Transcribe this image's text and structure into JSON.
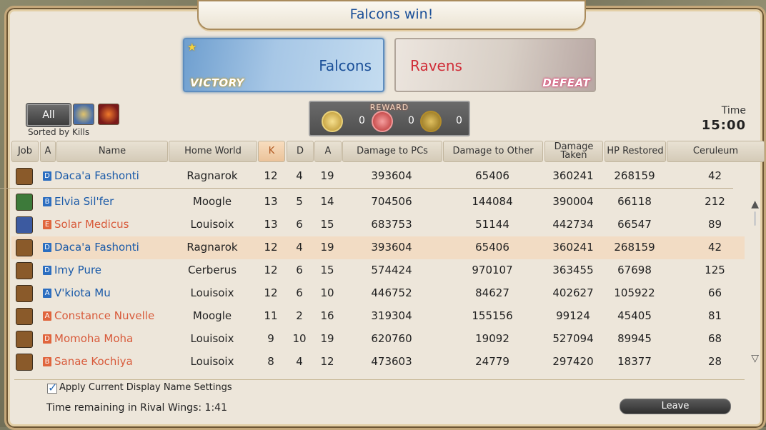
{
  "title": "Falcons win!",
  "teams": {
    "falcons": {
      "name": "Falcons",
      "result": "VICTORY"
    },
    "ravens": {
      "name": "Ravens",
      "result": "DEFEAT"
    }
  },
  "filter": {
    "all_label": "All",
    "sorted_by": "Sorted by Kills"
  },
  "reward": {
    "label": "REWARD",
    "counts": [
      "0",
      "0",
      "0"
    ]
  },
  "time": {
    "label": "Time",
    "value": "15:00"
  },
  "columns": {
    "job": "Job",
    "rank": "A",
    "name": "Name",
    "home_world": "Home World",
    "k": "K",
    "d": "D",
    "a": "A",
    "damage_pcs": "Damage to PCs",
    "damage_other": "Damage to Other",
    "damage_taken": "Damage Taken",
    "hp_restored": "HP Restored",
    "ceruleum": "Ceruleum"
  },
  "self_row": {
    "rank": "D",
    "team": "falcon",
    "name": "Daca'a Fashonti",
    "world": "Ragnarok",
    "k": "12",
    "d": "4",
    "a": "19",
    "dmg_pcs": "393604",
    "dmg_other": "65406",
    "dmg_taken": "360241",
    "hp": "268159",
    "ceruleum": "42",
    "job_color": "#8a5a2a"
  },
  "rows": [
    {
      "rank": "B",
      "team": "falcon",
      "name": "Elvia Sil'fer",
      "world": "Moogle",
      "k": "13",
      "d": "5",
      "a": "14",
      "dmg_pcs": "704506",
      "dmg_other": "144084",
      "dmg_taken": "390004",
      "hp": "66118",
      "ceruleum": "212",
      "job_color": "#3d7a3a"
    },
    {
      "rank": "E",
      "team": "raven",
      "name": "Solar Medicus",
      "world": "Louisoix",
      "k": "13",
      "d": "6",
      "a": "15",
      "dmg_pcs": "683753",
      "dmg_other": "51144",
      "dmg_taken": "442734",
      "hp": "66547",
      "ceruleum": "89",
      "job_color": "#3c5aa0"
    },
    {
      "rank": "D",
      "team": "falcon",
      "name": "Daca'a Fashonti",
      "world": "Ragnarok",
      "k": "12",
      "d": "4",
      "a": "19",
      "dmg_pcs": "393604",
      "dmg_other": "65406",
      "dmg_taken": "360241",
      "hp": "268159",
      "ceruleum": "42",
      "job_color": "#8a5a2a",
      "me": true
    },
    {
      "rank": "D",
      "team": "falcon",
      "name": "Imy Pure",
      "world": "Cerberus",
      "k": "12",
      "d": "6",
      "a": "15",
      "dmg_pcs": "574424",
      "dmg_other": "970107",
      "dmg_taken": "363455",
      "hp": "67698",
      "ceruleum": "125",
      "job_color": "#8a5a2a"
    },
    {
      "rank": "A",
      "team": "falcon",
      "name": "V'kiota Mu",
      "world": "Louisoix",
      "k": "12",
      "d": "6",
      "a": "10",
      "dmg_pcs": "446752",
      "dmg_other": "84627",
      "dmg_taken": "402627",
      "hp": "105922",
      "ceruleum": "66",
      "job_color": "#8a5a2a"
    },
    {
      "rank": "A",
      "team": "raven",
      "name": "Constance Nuvelle",
      "world": "Moogle",
      "k": "11",
      "d": "2",
      "a": "16",
      "dmg_pcs": "319304",
      "dmg_other": "155156",
      "dmg_taken": "99124",
      "hp": "45405",
      "ceruleum": "81",
      "job_color": "#8a5a2a"
    },
    {
      "rank": "D",
      "team": "raven",
      "name": "Momoha Moha",
      "world": "Louisoix",
      "k": "9",
      "d": "10",
      "a": "19",
      "dmg_pcs": "620760",
      "dmg_other": "19092",
      "dmg_taken": "527094",
      "hp": "89945",
      "ceruleum": "68",
      "job_color": "#8a5a2a"
    },
    {
      "rank": "B",
      "team": "raven",
      "name": "Sanae Kochiya",
      "world": "Louisoix",
      "k": "8",
      "d": "4",
      "a": "12",
      "dmg_pcs": "473603",
      "dmg_other": "24779",
      "dmg_taken": "297420",
      "hp": "18377",
      "ceruleum": "28",
      "job_color": "#8a5a2a"
    }
  ],
  "footer": {
    "checkbox_label": "Apply Current Display Name Settings",
    "checkbox_checked": true,
    "time_remaining": "Time remaining in Rival Wings: 1:41",
    "leave_label": "Leave"
  }
}
